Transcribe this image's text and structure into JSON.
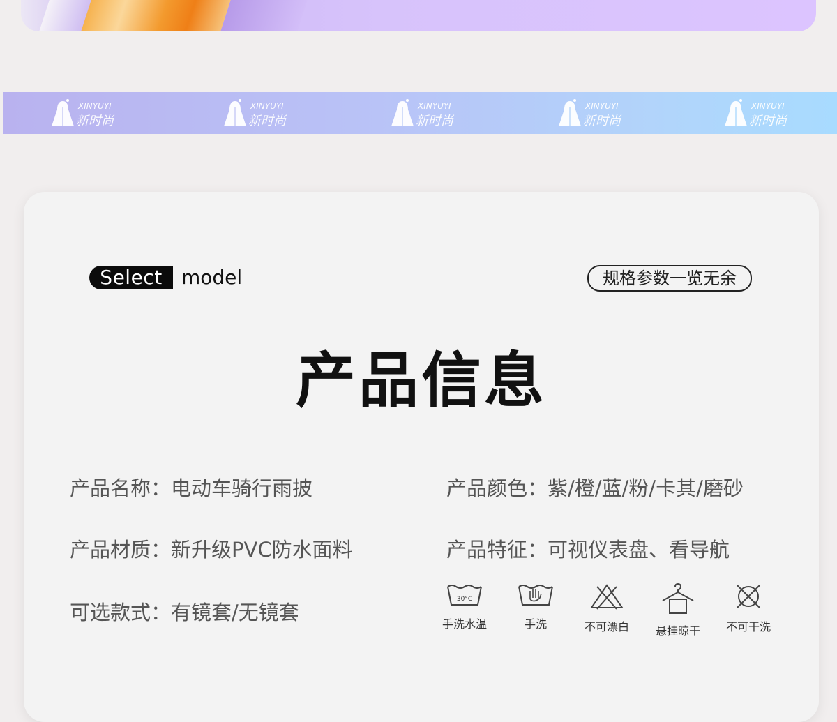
{
  "banner": {
    "logos": [
      {
        "en": "XINYUYI",
        "cn": "新时尚"
      },
      {
        "en": "XINYUYI",
        "cn": "新时尚"
      },
      {
        "en": "XINYUYI",
        "cn": "新时尚"
      },
      {
        "en": "XINYUYI",
        "cn": "新时尚"
      },
      {
        "en": "XINYUYI",
        "cn": "新时尚"
      }
    ]
  },
  "card": {
    "select_label": "Select",
    "model_label": "model",
    "spec_badge": "规格参数一览无余",
    "title": "产品信息",
    "info": [
      "产品名称：电动车骑行雨披",
      "产品材质：新升级PVC防水面料",
      "可选款式：有镜套/无镜套",
      "产品颜色：紫/橙/蓝/粉/卡其/磨砂",
      "产品特征：可视仪表盘、看导航"
    ],
    "care": [
      {
        "icon": "wash-30c-icon",
        "label": "手洗水温",
        "temp": "30°C"
      },
      {
        "icon": "hand-wash-icon",
        "label": "手洗"
      },
      {
        "icon": "no-bleach-icon",
        "label": "不可漂白"
      },
      {
        "icon": "hang-dry-icon",
        "label": "悬挂晾干"
      },
      {
        "icon": "no-dry-clean-icon",
        "label": "不可干洗"
      }
    ]
  },
  "colors": {
    "title": "#111111",
    "info_text": "#555555",
    "card_bg": "#f3f3f3",
    "page_bg": "#f1eeee"
  }
}
